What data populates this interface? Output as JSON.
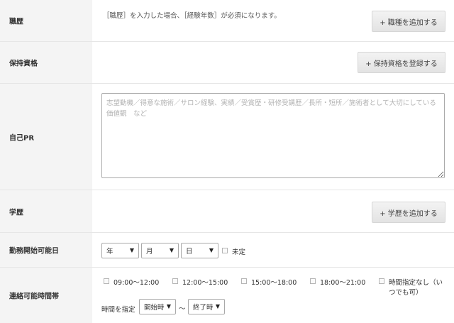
{
  "career": {
    "label": "職歴",
    "note": "［職歴］を入力した場合、［経験年数］が必須になります。",
    "add_button": "+ 職種を追加する"
  },
  "qualifications": {
    "label": "保持資格",
    "add_button": "+ 保持資格を登録する"
  },
  "self_pr": {
    "label": "自己PR",
    "placeholder": "志望動機／得意な施術／サロン経験、実績／受賞歴・研修受講歴／長所・短所／施術者として大切にしている価値観　など"
  },
  "education": {
    "label": "学歴",
    "add_button": "+ 学歴を追加する"
  },
  "start_date": {
    "label": "勤務開始可能日",
    "year": "年",
    "month": "月",
    "day": "日",
    "undecided": "未定"
  },
  "contact_time": {
    "label": "連絡可能時間帯",
    "slots": [
      "09:00〜12:00",
      "12:00〜15:00",
      "15:00〜18:00",
      "18:00〜21:00"
    ],
    "anytime_line1": "時間指定なし（い",
    "anytime_line2": "つでも可）",
    "specify_label": "時間を指定",
    "start_select": "開始時",
    "tilde": "〜",
    "end_select": "終了時"
  }
}
